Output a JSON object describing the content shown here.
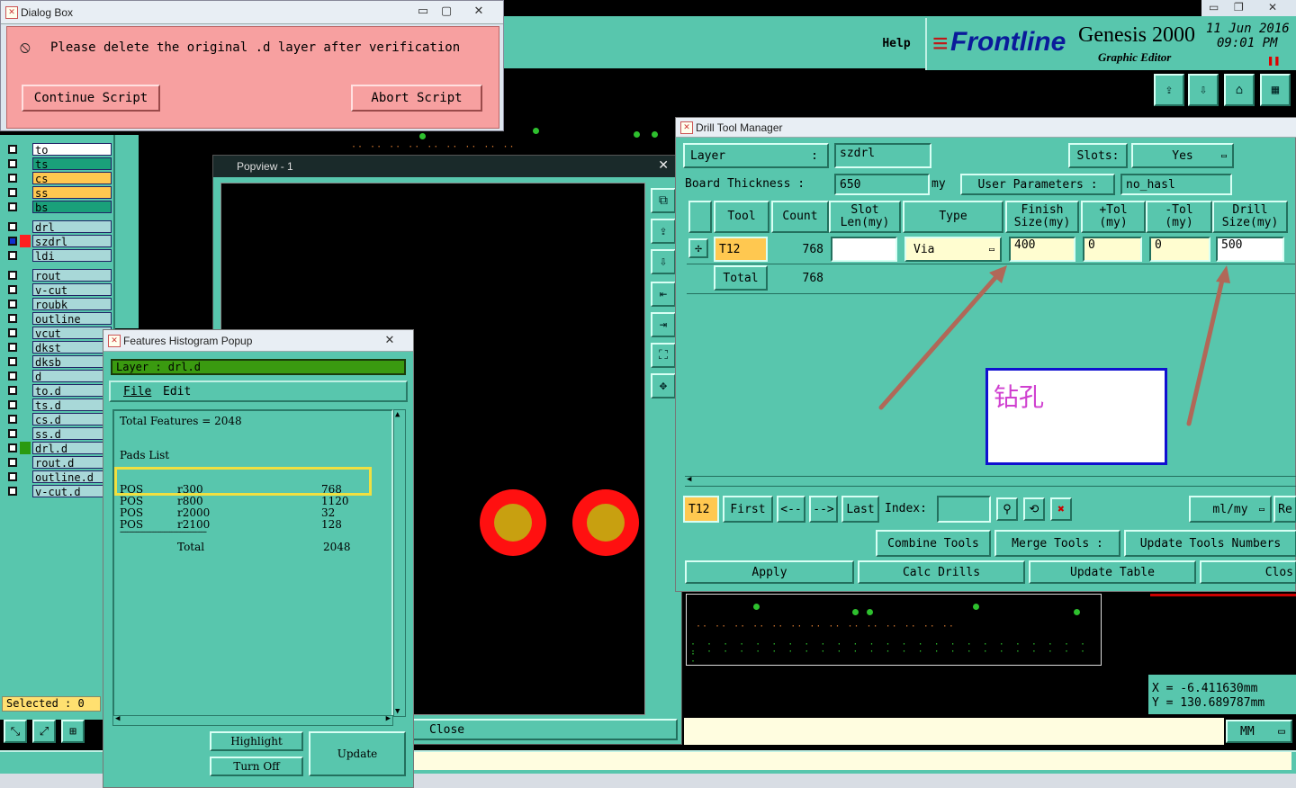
{
  "dialog_box": {
    "title": "Dialog Box",
    "message": "Please delete the original .d layer after verification",
    "continue_label": "Continue Script",
    "abort_label": "Abort Script"
  },
  "header": {
    "help_label": "Help",
    "brand": "Frontline",
    "product": "Genesis 2000",
    "subtitle": "Graphic Editor",
    "date": "11 Jun 2016",
    "time": "09:01  PM"
  },
  "layers": [
    {
      "name": "to",
      "color": "#ffffff"
    },
    {
      "name": "ts",
      "color": "#1aa07a"
    },
    {
      "name": "cs",
      "color": "#ffc850"
    },
    {
      "name": "ss",
      "color": "#ffc850"
    },
    {
      "name": "bs",
      "color": "#1aa07a"
    },
    {
      "name": "drl",
      "color": "#a8d8d8"
    },
    {
      "name": "szdrl",
      "color": "#a8d8d8"
    },
    {
      "name": "ldi",
      "color": "#a8d8d8"
    },
    {
      "name": "rout",
      "color": "#a8d8d8"
    },
    {
      "name": "v-cut",
      "color": "#a8d8d8"
    },
    {
      "name": "roubk",
      "color": "#a8d8d8"
    },
    {
      "name": "outline",
      "color": "#a8d8d8"
    },
    {
      "name": "vcut",
      "color": "#a8d8d8"
    },
    {
      "name": "dkst",
      "color": "#a8d8d8"
    },
    {
      "name": "dksb",
      "color": "#a8d8d8"
    },
    {
      "name": "d",
      "color": "#a8d8d8"
    },
    {
      "name": "to.d",
      "color": "#a8d8d8"
    },
    {
      "name": "ts.d",
      "color": "#a8d8d8"
    },
    {
      "name": "cs.d",
      "color": "#a8d8d8"
    },
    {
      "name": "ss.d",
      "color": "#a8d8d8"
    },
    {
      "name": "drl.d",
      "color": "#a8d8d8"
    },
    {
      "name": "rout.d",
      "color": "#a8d8d8"
    },
    {
      "name": "outline.d",
      "color": "#a8d8d8"
    },
    {
      "name": "v-cut.d",
      "color": "#a8d8d8"
    }
  ],
  "selected_label": "Selected : 0",
  "popview": {
    "title": "Popview - 1",
    "close_label": "Close"
  },
  "histogram": {
    "title": "Features Histogram Popup",
    "layer_label": "Layer :  drl.d",
    "menu_file": "File",
    "menu_edit": "Edit",
    "total_features": "Total Features = 2048",
    "pads_list": "Pads List",
    "rows": [
      {
        "type": "POS",
        "symbol": "r300",
        "count": "768"
      },
      {
        "type": "POS",
        "symbol": "r800",
        "count": "1120"
      },
      {
        "type": "POS",
        "symbol": "r2000",
        "count": "32"
      },
      {
        "type": "POS",
        "symbol": "r2100",
        "count": "128"
      }
    ],
    "separator": "-----------------------------------------------",
    "total_label": "Total",
    "total_value": "2048",
    "highlight_label": "Highlight",
    "turn_off_label": "Turn Off",
    "update_label": "Update"
  },
  "drill": {
    "title": "Drill Tool Manager",
    "layer_label": "Layer",
    "layer_value": "szdrl",
    "slots_label": "Slots:",
    "slots_value": "Yes",
    "thickness_label": "Board Thickness :",
    "thickness_value": "650",
    "thickness_unit": "my",
    "user_params_label": "User Parameters :",
    "user_params_value": "no_hasl",
    "columns": [
      "Tool",
      "Count",
      "Slot\nLen(my)",
      "Type",
      "Finish\nSize(my)",
      "+Tol\n(my)",
      "-Tol\n(my)",
      "Drill\nSize(my)"
    ],
    "row": {
      "tool": "T12",
      "count": "768",
      "slot_len": "",
      "type": "Via",
      "finish": "400",
      "plus_tol": "0",
      "minus_tol": "0",
      "drill": "500"
    },
    "total_label": "Total",
    "total_count": "768",
    "annotation": "钻孔",
    "nav_tool": "T12",
    "first_label": "First",
    "prev_label": "<--",
    "next_label": "-->",
    "last_label": "Last",
    "index_label": "Index:",
    "units_value": "ml/my",
    "re_label": "Re",
    "combine_label": "Combine Tools",
    "merge_label": "Merge Tools :",
    "update_numbers_label": "Update Tools Numbers",
    "apply_label": "Apply",
    "calc_label": "Calc Drills",
    "update_table_label": "Update Table",
    "close_label": "Clos"
  },
  "coords": {
    "x": "X  =  -6.411630mm",
    "y": "Y  =  130.689787mm"
  },
  "units_bottom": "MM"
}
